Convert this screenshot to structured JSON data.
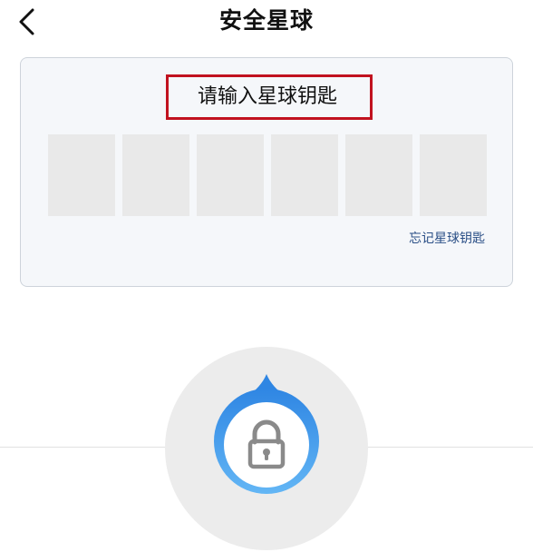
{
  "header": {
    "title": "安全星球",
    "back_icon": "chevron-left-icon"
  },
  "key_card": {
    "prompt": "请输入星球钥匙",
    "digit_count": 6,
    "forgot_link": "忘记星球钥匙",
    "highlight_color": "#c1121f"
  },
  "lock": {
    "icon": "lock-icon",
    "ring_color": "#3d8fe6"
  },
  "colors": {
    "link": "#2a4f86",
    "card_background": "#f5f7fa",
    "digit_cell": "#e9e9e9"
  }
}
